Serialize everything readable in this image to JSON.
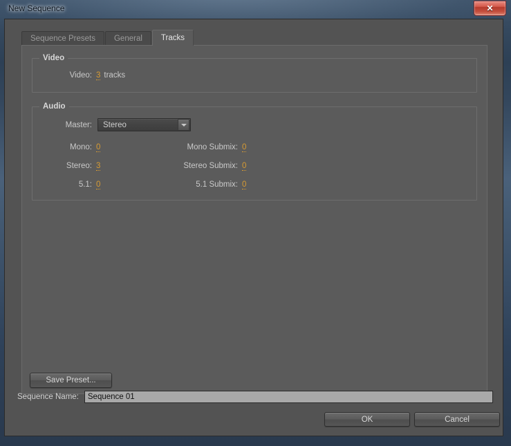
{
  "window": {
    "title": "New Sequence",
    "close_icon": "close-icon",
    "close_glyph": "✕"
  },
  "tabs": [
    {
      "label": "Sequence Presets",
      "active": false
    },
    {
      "label": "General",
      "active": false
    },
    {
      "label": "Tracks",
      "active": true
    }
  ],
  "video_group": {
    "title": "Video",
    "row": {
      "label": "Video:",
      "value": "3",
      "unit": "tracks"
    }
  },
  "audio_group": {
    "title": "Audio",
    "master": {
      "label": "Master:",
      "value": "Stereo",
      "arrow_icon": "chevron-down-icon",
      "options": [
        "Stereo"
      ]
    },
    "rows": [
      {
        "left_label": "Mono:",
        "left_value": "0",
        "right_label": "Mono Submix:",
        "right_value": "0"
      },
      {
        "left_label": "Stereo:",
        "left_value": "3",
        "right_label": "Stereo Submix:",
        "right_value": "0"
      },
      {
        "left_label": "5.1:",
        "left_value": "0",
        "right_label": "5.1 Submix:",
        "right_value": "0"
      }
    ]
  },
  "save_preset": {
    "label": "Save Preset..."
  },
  "sequence_name": {
    "label": "Sequence Name:",
    "value": "Sequence 01",
    "placeholder": "Sequence 01"
  },
  "footer": {
    "ok_label": "OK",
    "cancel_label": "Cancel"
  },
  "colors": {
    "panel_bg": "#5b5b5b",
    "client_bg": "#535353",
    "scrub_value": "#d79b33",
    "label_text": "#c9c9c9",
    "close_red": "#c4503f",
    "input_bg": "#a9a9a9"
  }
}
